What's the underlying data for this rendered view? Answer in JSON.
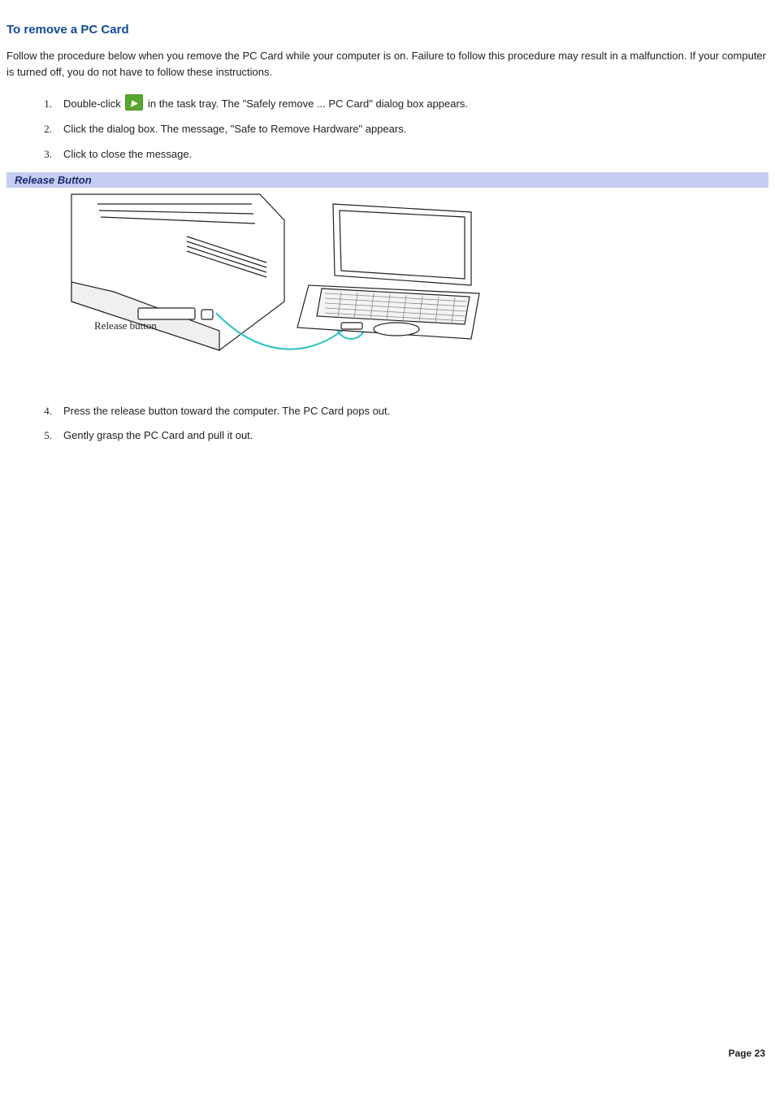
{
  "heading": "To remove a PC Card",
  "intro": "Follow the procedure below when you remove the PC Card while your computer is on. Failure to follow this procedure may result in a malfunction. If your computer is turned off, you do not have to follow these instructions.",
  "steps_first": [
    {
      "num": "1.",
      "before": "Double-click ",
      "after": " in the task tray. The \"Safely remove ... PC Card\" dialog box appears.",
      "has_icon": true
    },
    {
      "num": "2.",
      "text": "Click the dialog box. The message, \"Safe to Remove Hardware\" appears."
    },
    {
      "num": "3.",
      "text": "Click to close the message."
    }
  ],
  "figure_title": "Release Button",
  "figure_label": "Release button",
  "steps_second": [
    {
      "num": "4.",
      "text": "Press the release button toward the computer. The PC Card pops out."
    },
    {
      "num": "5.",
      "text": "Gently grasp the PC Card and pull it out."
    }
  ],
  "page_footer": "Page 23"
}
